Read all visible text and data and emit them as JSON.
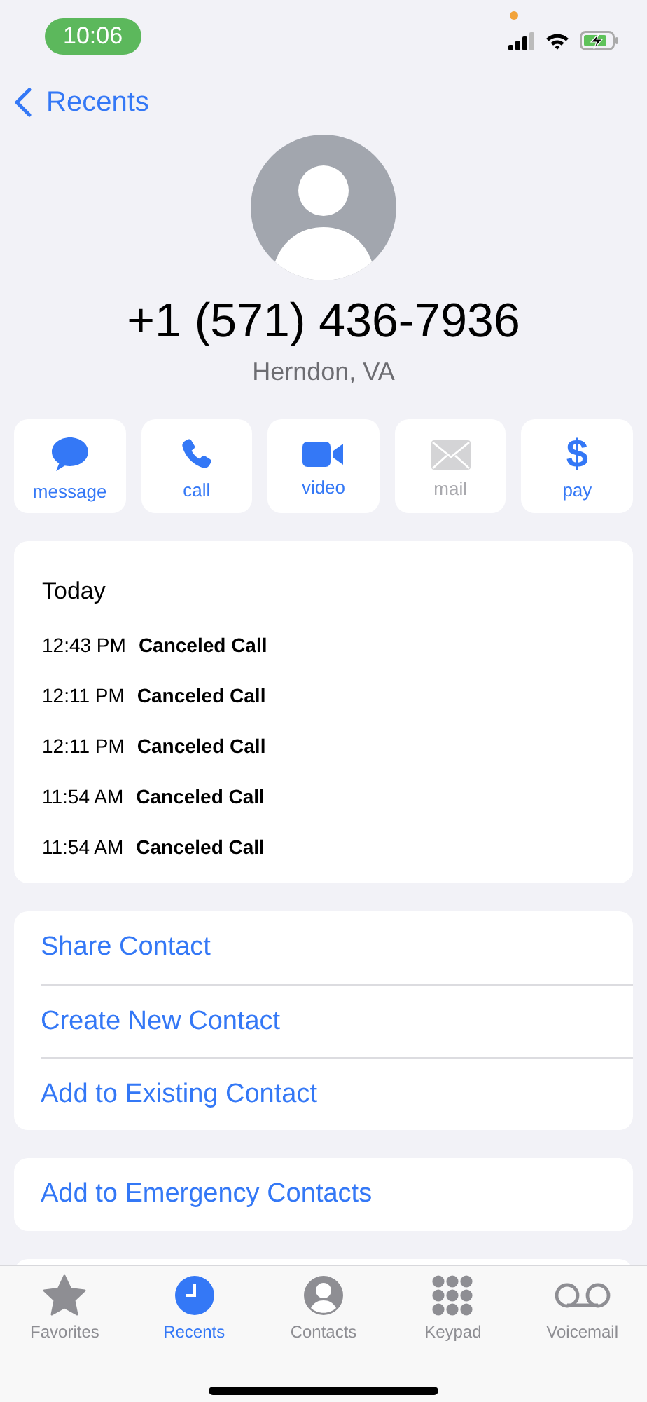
{
  "status_bar": {
    "time": "10:06"
  },
  "nav": {
    "back_label": "Recents"
  },
  "contact": {
    "number": "+1 (571) 436-7936",
    "location": "Herndon, VA"
  },
  "actions": [
    {
      "kind": "message",
      "label": "message",
      "disabled": false
    },
    {
      "kind": "call",
      "label": "call",
      "disabled": false
    },
    {
      "kind": "video",
      "label": "video",
      "disabled": false
    },
    {
      "kind": "mail",
      "label": "mail",
      "disabled": true
    },
    {
      "kind": "pay",
      "label": "pay",
      "icon": "$",
      "disabled": false
    }
  ],
  "history": {
    "heading": "Today",
    "entries": [
      {
        "time": "12:43 PM",
        "type": "Canceled Call"
      },
      {
        "time": "12:11 PM",
        "type": "Canceled Call"
      },
      {
        "time": "12:11 PM",
        "type": "Canceled Call"
      },
      {
        "time": "11:54 AM",
        "type": "Canceled Call"
      },
      {
        "time": "11:54 AM",
        "type": "Canceled Call"
      }
    ]
  },
  "contact_options": [
    "Share Contact",
    "Create New Contact",
    "Add to Existing Contact"
  ],
  "emergency_option": "Add to Emergency Contacts",
  "tabs": [
    {
      "kind": "favorites",
      "label": "Favorites",
      "selected": false
    },
    {
      "kind": "recents",
      "label": "Recents",
      "selected": true
    },
    {
      "kind": "contacts",
      "label": "Contacts",
      "selected": false
    },
    {
      "kind": "keypad",
      "label": "Keypad",
      "selected": false
    },
    {
      "kind": "voicemail",
      "label": "Voicemail",
      "selected": false
    }
  ]
}
